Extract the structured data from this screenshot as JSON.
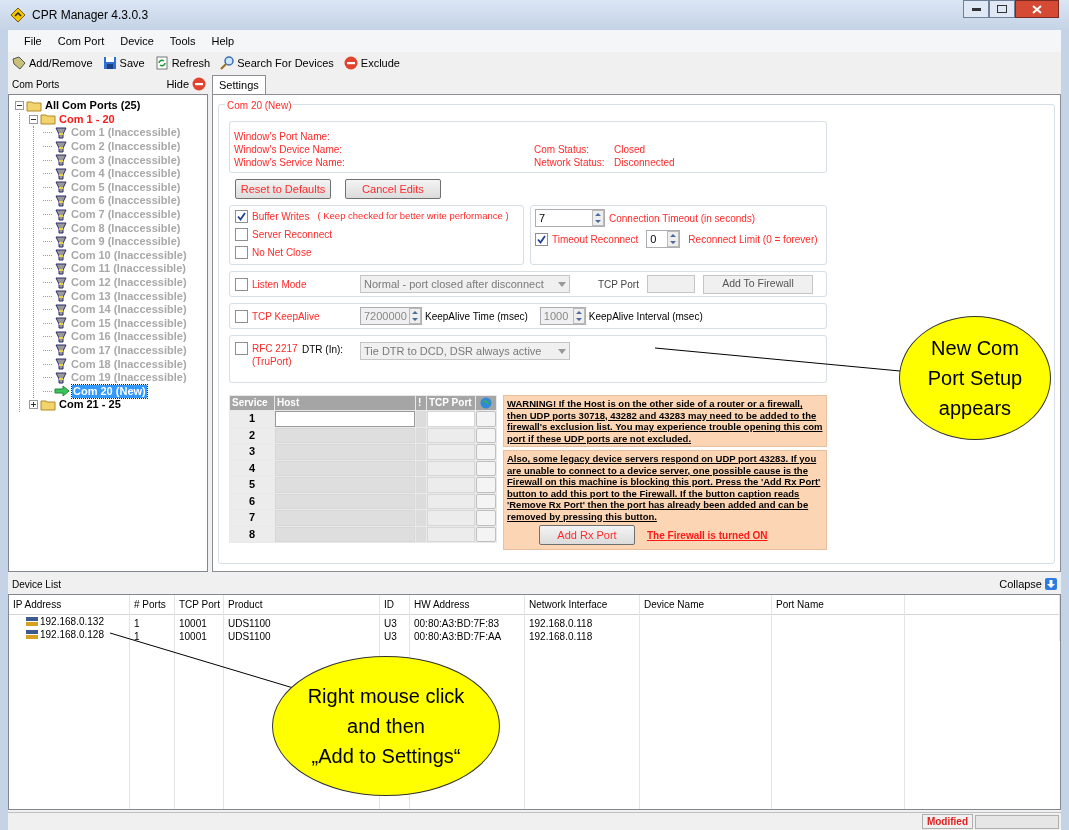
{
  "window": {
    "title": "CPR Manager 4.3.0.3"
  },
  "menu": [
    "File",
    "Com Port",
    "Device",
    "Tools",
    "Help"
  ],
  "toolbar": [
    {
      "label": "Add/Remove",
      "kind": "add"
    },
    {
      "label": "Save",
      "kind": "save"
    },
    {
      "label": "Refresh",
      "kind": "refresh"
    },
    {
      "label": "Search For Devices",
      "kind": "search"
    },
    {
      "label": "Exclude",
      "kind": "exclude"
    }
  ],
  "com_ports": {
    "title": "Com Ports",
    "hide": "Hide",
    "tree": [
      {
        "label": "All Com Ports (25)",
        "kind": "folder",
        "current": false,
        "expanded": true,
        "children": [
          {
            "label": "Com 1 - 20",
            "kind": "folder",
            "current": true,
            "expanded": true,
            "children": [
              {
                "label": "Com 1 (Inaccessible)",
                "kind": "port",
                "selected": false
              },
              {
                "label": "Com 2 (Inaccessible)",
                "kind": "port",
                "selected": false
              },
              {
                "label": "Com 3 (Inaccessible)",
                "kind": "port",
                "selected": false
              },
              {
                "label": "Com 4 (Inaccessible)",
                "kind": "port",
                "selected": false
              },
              {
                "label": "Com 5 (Inaccessible)",
                "kind": "port",
                "selected": false
              },
              {
                "label": "Com 6 (Inaccessible)",
                "kind": "port",
                "selected": false
              },
              {
                "label": "Com 7 (Inaccessible)",
                "kind": "port",
                "selected": false
              },
              {
                "label": "Com 8 (Inaccessible)",
                "kind": "port",
                "selected": false
              },
              {
                "label": "Com 9 (Inaccessible)",
                "kind": "port",
                "selected": false
              },
              {
                "label": "Com 10 (Inaccessible)",
                "kind": "port",
                "selected": false
              },
              {
                "label": "Com 11 (Inaccessible)",
                "kind": "port",
                "selected": false
              },
              {
                "label": "Com 12 (Inaccessible)",
                "kind": "port",
                "selected": false
              },
              {
                "label": "Com 13 (Inaccessible)",
                "kind": "port",
                "selected": false
              },
              {
                "label": "Com 14 (Inaccessible)",
                "kind": "port",
                "selected": false
              },
              {
                "label": "Com 15 (Inaccessible)",
                "kind": "port",
                "selected": false
              },
              {
                "label": "Com 16 (Inaccessible)",
                "kind": "port",
                "selected": false
              },
              {
                "label": "Com 17 (Inaccessible)",
                "kind": "port",
                "selected": false
              },
              {
                "label": "Com 18 (Inaccessible)",
                "kind": "port",
                "selected": false
              },
              {
                "label": "Com 19 (Inaccessible)",
                "kind": "port",
                "selected": false
              },
              {
                "label": "Com 20 (New)",
                "kind": "new",
                "selected": true
              }
            ]
          },
          {
            "label": "Com 21 - 25",
            "kind": "folder",
            "current": false,
            "expanded": false
          }
        ]
      }
    ]
  },
  "tabs": [
    {
      "label": "Settings",
      "selected": true
    }
  ],
  "settings": {
    "group_title": "Com 20 (New)",
    "names": [
      "Window's Port Name:",
      "Window's Device Name:",
      "Window's Service Name:"
    ],
    "status": [
      {
        "label": "Com Status:",
        "value": "Closed"
      },
      {
        "label": "Network Status:",
        "value": "Disconnected"
      }
    ],
    "buttons": [
      "Reset to Defaults",
      "Cancel Edits"
    ],
    "options": [
      {
        "label": "Buffer Writes",
        "note": "( Keep checked for better write performance )",
        "checked": true
      },
      {
        "label": "Server Reconnect",
        "checked": false
      },
      {
        "label": "No Net Close",
        "checked": false
      }
    ],
    "connection": {
      "timeout_value": "7",
      "timeout_label": "Connection Timeout (in seconds)",
      "reconnect_label": "Timeout Reconnect",
      "reconnect_checked": true,
      "limit_value": "0",
      "limit_label": "Reconnect Limit (0 = forever)"
    },
    "listen": {
      "label": "Listen Mode",
      "checked": false,
      "mode": "Normal - port closed after disconnect",
      "tcp_port_label": "TCP Port",
      "firewall_button": "Add To Firewall"
    },
    "keepalive": {
      "label": "TCP KeepAlive",
      "checked": false,
      "time_value": "7200000",
      "time_label": "KeepAlive Time (msec)",
      "interval_value": "1000",
      "interval_label": "KeepAlive Interval (msec)"
    },
    "rfc": {
      "label": "RFC 2217",
      "sublabel": "(TruPort)",
      "checked": false,
      "dtr_label": "DTR (In):",
      "dtr_value": "Tie DTR to DCD, DSR always active"
    },
    "services": {
      "columns": [
        "Service",
        "Host",
        "!",
        "TCP Port"
      ],
      "rows": [
        {
          "number": "1",
          "enabled": true
        },
        {
          "number": "2",
          "enabled": false
        },
        {
          "number": "3",
          "enabled": false
        },
        {
          "number": "4",
          "enabled": false
        },
        {
          "number": "5",
          "enabled": false
        },
        {
          "number": "6",
          "enabled": false
        },
        {
          "number": "7",
          "enabled": false
        },
        {
          "number": "8",
          "enabled": false
        }
      ]
    },
    "warnings": [
      "WARNING! If the Host is on the other side of a router or a firewall, then UDP ports 30718, 43282 and 43283 may need to be added to the firewall's exclusion list. You may experience trouble opening this com port if these UDP ports are not excluded.",
      "Also, some legacy device servers respond on UDP port 43283.  If you are unable to connect to a device server, one possible cause is the Firewall on this machine is blocking this port.  Press the 'Add Rx Port' button to add this port to the Firewall.   If the button caption reads 'Remove Rx Port' then the port has already been added and can be removed by pressing this button."
    ],
    "rx_button": "Add Rx Port",
    "firewall_status": "The Firewall is turned ON"
  },
  "device_list": {
    "title": "Device List",
    "collapse": "Collapse",
    "columns": [
      "IP Address",
      "# Ports",
      "TCP Port",
      "Product",
      "ID",
      "HW Address",
      "Network Interface",
      "Device Name",
      "Port Name"
    ],
    "rows": [
      [
        "192.168.0.132",
        "1",
        "10001",
        "UDS1100",
        "U3",
        "00:80:A3:BD:7F:83",
        "192.168.0.118"
      ],
      [
        "192.168.0.128",
        "1",
        "10001",
        "UDS1100",
        "U3",
        "00:80:A3:BD:7F:AA",
        "192.168.0.118"
      ]
    ]
  },
  "status_bar": {
    "text": "Modified"
  },
  "callouts": [
    [
      "New Com",
      "Port Setup",
      "appears"
    ],
    [
      "Right mouse click",
      "and then",
      "„Add to Settings“"
    ]
  ]
}
